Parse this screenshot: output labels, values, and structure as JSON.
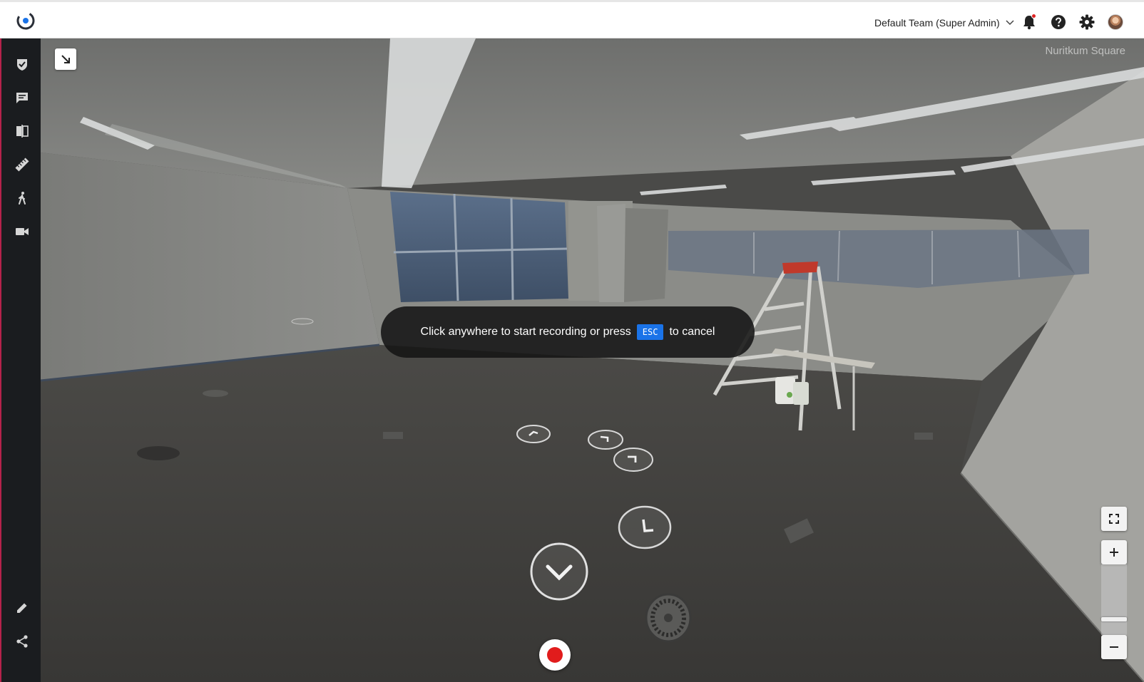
{
  "header": {
    "team_label": "Default Team (Super Admin)",
    "icons": [
      "notification-bell-icon",
      "help-icon",
      "settings-gear-icon",
      "user-avatar"
    ]
  },
  "sidebar": {
    "items": [
      {
        "name": "tasks",
        "icon": "shield-check-icon"
      },
      {
        "name": "comments",
        "icon": "comment-icon"
      },
      {
        "name": "compare",
        "icon": "compare-icon"
      },
      {
        "name": "measure",
        "icon": "ruler-icon"
      },
      {
        "name": "walkthrough",
        "icon": "walking-person-icon"
      },
      {
        "name": "video",
        "icon": "video-camera-icon"
      }
    ],
    "bottom_items": [
      {
        "name": "edit",
        "icon": "pencil-icon"
      },
      {
        "name": "share",
        "icon": "share-icon"
      }
    ]
  },
  "viewer": {
    "space_name": "Nuritkum Square",
    "banner": {
      "before": "Click anywhere to start recording or press",
      "key": "ESC",
      "after": "to cancel"
    },
    "zoom_level": 0.2
  },
  "colors": {
    "record": "#e11c1c",
    "esc_key": "#1a73e8",
    "sidebar_bg": "#1a1c1f",
    "notification_dot": "#e02424"
  }
}
